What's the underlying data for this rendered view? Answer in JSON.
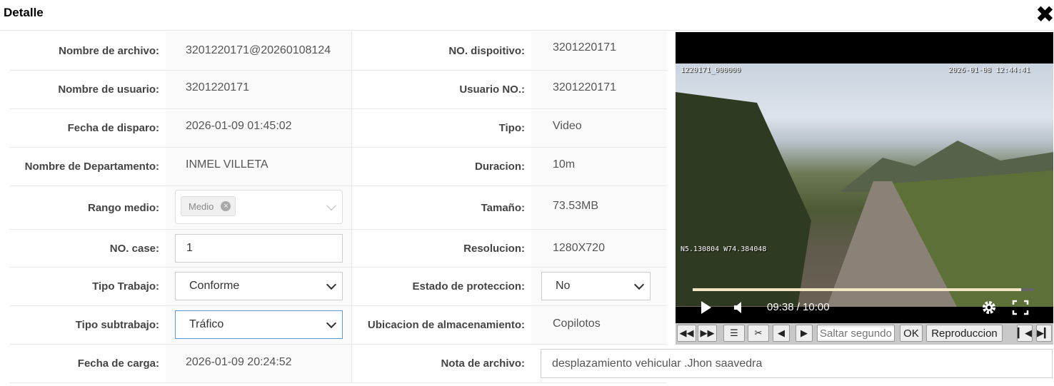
{
  "header": {
    "title": "Detalle",
    "close_icon": "close-icon"
  },
  "fields": {
    "nombre_archivo": {
      "label": "Nombre de archivo:",
      "value": "3201220171@20260108124"
    },
    "no_dispositivo": {
      "label": "NO. dispoitivo:",
      "value": "3201220171"
    },
    "nombre_usuario": {
      "label": "Nombre de usuario:",
      "value": "3201220171"
    },
    "usuario_no": {
      "label": "Usuario NO.:",
      "value": "3201220171"
    },
    "fecha_disparo": {
      "label": "Fecha de disparo:",
      "value": "2026-01-09 01:45:02"
    },
    "tipo": {
      "label": "Tipo:",
      "value": "Video"
    },
    "departamento": {
      "label": "Nombre de Departamento:",
      "value": "INMEL VILLETA"
    },
    "duracion": {
      "label": "Duracion:",
      "value": "10m"
    },
    "rango_medio": {
      "label": "Rango medio:",
      "tag": "Medio"
    },
    "tamano": {
      "label": "Tamaño:",
      "value": "73.53MB"
    },
    "no_case": {
      "label": "NO. case:",
      "value": "1"
    },
    "resolucion": {
      "label": "Resolucion:",
      "value": "1280X720"
    },
    "tipo_trabajo": {
      "label": "Tipo Trabajo:",
      "value": "Conforme"
    },
    "estado_proteccion": {
      "label": "Estado de proteccion:",
      "value": "No"
    },
    "tipo_subtrabajo": {
      "label": "Tipo subtrabajo:",
      "value": "Tráfico"
    },
    "ubicacion": {
      "label": "Ubicacion de almacenamiento:",
      "value": "Copilotos"
    },
    "fecha_carga": {
      "label": "Fecha de carga:",
      "value": "2026-01-09 20:24:52"
    },
    "nota_archivo": {
      "label": "Nota de archivo:",
      "value": "desplazamiento vehicular .Jhon saavedra"
    }
  },
  "player": {
    "osd_id": "1220171_000000",
    "osd_datetime": "2026-01-08  12:44:41",
    "osd_coords": "N5.130804  W74.384048",
    "time": "09:38 / 10:00",
    "progress": 0.963
  },
  "toolbar": {
    "seek_placeholder": "Saltar segundos",
    "ok_label": "OK",
    "reproduccion_label": "Reproduccion"
  }
}
